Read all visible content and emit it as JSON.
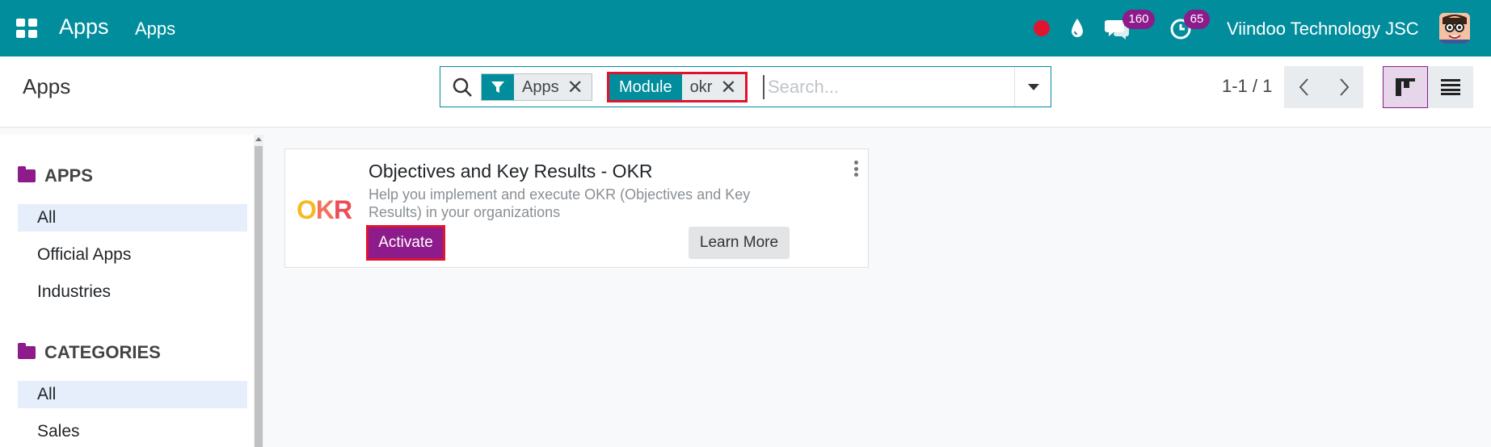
{
  "navbar": {
    "brand": "Apps",
    "menu_item": "Apps",
    "chat_count": "160",
    "activity_count": "65",
    "company": "Viindoo Technology JSC",
    "colors": {
      "navbar": "#018d9c",
      "badge": "#8d1b8b",
      "recording": "#e0142f"
    }
  },
  "control_panel": {
    "title": "Apps",
    "search": {
      "facets": [
        {
          "icon": "filter-icon",
          "value": "Apps"
        },
        {
          "label": "Module",
          "value": "okr"
        }
      ],
      "placeholder": "Search..."
    },
    "pager": "1-1 / 1",
    "views": [
      "kanban",
      "list"
    ],
    "active_view": "kanban"
  },
  "sidebar": {
    "apps_heading": "APPS",
    "apps_items": [
      "All",
      "Official Apps",
      "Industries"
    ],
    "categories_heading": "CATEGORIES",
    "categories_items": [
      "All",
      "Sales"
    ]
  },
  "card": {
    "logo": {
      "o": "O",
      "k": "K",
      "r": "R"
    },
    "title": "Objectives and Key Results - OKR",
    "description": "Help you implement and execute OKR (Objectives and Key Results) in your organizations",
    "activate_label": "Activate",
    "learn_more_label": "Learn More"
  }
}
